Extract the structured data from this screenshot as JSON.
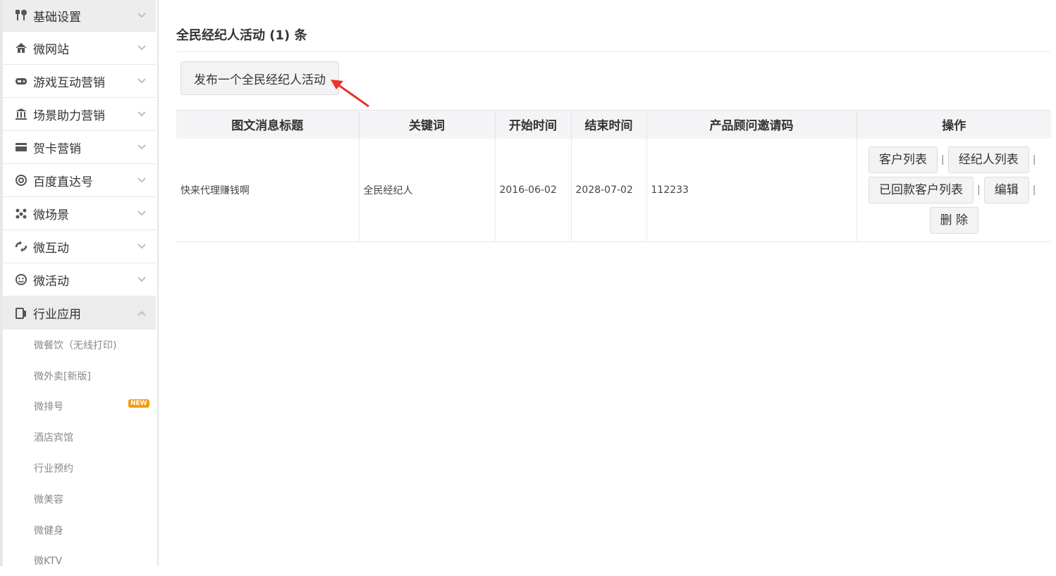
{
  "sidebar": {
    "items": [
      {
        "label": "基础设置",
        "icon": "tools-icon"
      },
      {
        "label": "微网站",
        "icon": "home-icon"
      },
      {
        "label": "游戏互动营销",
        "icon": "gamepad-icon"
      },
      {
        "label": "场景助力营销",
        "icon": "bank-icon"
      },
      {
        "label": "贺卡营销",
        "icon": "card-icon"
      },
      {
        "label": "百度直达号",
        "icon": "at-icon"
      },
      {
        "label": "微场景",
        "icon": "molecule-icon"
      },
      {
        "label": "微互动",
        "icon": "swap-icon"
      },
      {
        "label": "微活动",
        "icon": "face-icon"
      },
      {
        "label": "行业应用",
        "icon": "device-icon"
      }
    ],
    "submenu": [
      {
        "label": "微餐饮（无线打印)"
      },
      {
        "label": "微外卖[新版]"
      },
      {
        "label": "微排号",
        "badge": "NEW"
      },
      {
        "label": "酒店宾馆"
      },
      {
        "label": "行业预约"
      },
      {
        "label": "微美容"
      },
      {
        "label": "微健身"
      },
      {
        "label": "微KTV"
      }
    ]
  },
  "main": {
    "title": "全民经纪人活动 (1) 条",
    "publish_button": "发布一个全民经纪人活动",
    "table": {
      "headers": [
        "图文消息标题",
        "关键词",
        "开始时间",
        "结束时间",
        "产品顾问邀请码",
        "操作"
      ],
      "rows": [
        {
          "title": "快来代理赚钱啊",
          "keyword": "全民经纪人",
          "start": "2016-06-02",
          "end": "2028-07-02",
          "code": "112233",
          "actions": [
            "客户列表",
            "经纪人列表",
            "已回款客户列表",
            "编辑",
            "删 除"
          ],
          "separator": "|"
        }
      ]
    }
  },
  "colors": {
    "arrow": "#e8332a",
    "badge": "#f39c12"
  }
}
